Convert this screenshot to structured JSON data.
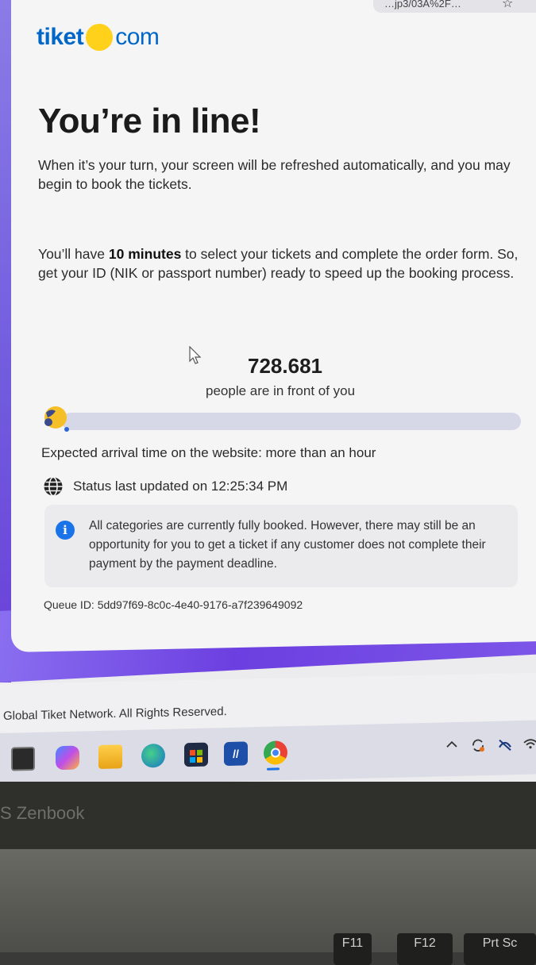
{
  "browser": {
    "url_fragment": "…jp3/03A%2F…",
    "star": "☆"
  },
  "logo": {
    "left": "tiket",
    "right": "com"
  },
  "heading": "You’re in line!",
  "intro": "When it’s your turn, your screen will be refreshed automatically, and you may begin to book the tickets.",
  "time_notice": {
    "before": "You’ll have ",
    "bold": "10 minutes",
    "after": " to select your tickets and complete the order form. So, get your ID (NIK or passport number) ready to speed up the booking process."
  },
  "queue": {
    "count": "728.681",
    "count_label": "people are in front of you",
    "progress_fraction": 0.0
  },
  "eta": "Expected arrival time on the website: more than an hour",
  "status": "Status last updated on 12:25:34 PM",
  "info_message": "All categories are currently fully booked. However, there may still be an opportunity for you to get a ticket if any customer does not complete their payment by the payment deadline.",
  "queue_id": "Queue ID: 5dd97f69-8c0c-4e40-9176-a7f239649092",
  "footer": "Global Tiket Network. All Rights Reserved.",
  "taskbar": {
    "apps": [
      "task-view-icon",
      "copilot-icon",
      "file-explorer-icon",
      "edge-icon",
      "store-icon",
      "asus-myasus-icon",
      "chrome-icon"
    ],
    "tray": [
      "chevron-up-icon",
      "sync-icon",
      "network-off-icon",
      "wifi-icon"
    ]
  },
  "laptop": {
    "brand": "S Zenbook",
    "keys": [
      "F11",
      "F12",
      "Prt Sc"
    ]
  },
  "colors": {
    "brand_blue": "#0067c8",
    "brand_yellow": "#ffd11a",
    "purple": "#6c3fe0",
    "info_blue": "#1a73e8"
  }
}
